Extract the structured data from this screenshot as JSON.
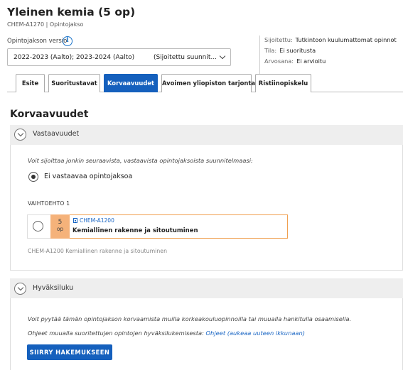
{
  "header": {
    "title": "Yleinen kemia (5 op)",
    "subtitle": "CHEM-A1270 | Opintojakso",
    "version_label": "Opintojakson versio",
    "version_value": "2022-2023 (Aalto); 2023-2024 (Aalto)",
    "version_status": "(Sijoitettu suunnit..."
  },
  "meta": {
    "placement_key": "Sijoitettu:",
    "placement_value": "Tutkintoon kuulumattomat opinnot",
    "state_key": "Tila:",
    "state_value": "Ei suoritusta",
    "grade_key": "Arvosana:",
    "grade_value": "Ei arvioitu"
  },
  "tabs": [
    {
      "label": "Esite",
      "active": false
    },
    {
      "label": "Suoritustavat",
      "active": false
    },
    {
      "label": "Korvaavuudet",
      "active": true
    },
    {
      "label": "Avoimen yliopiston tarjonta",
      "active": false
    },
    {
      "label": "Ristiinopiskelu",
      "active": false
    }
  ],
  "section_title": "Korvaavuudet",
  "equivalents": {
    "heading": "Vastaavuudet",
    "instructions": "Voit sijoittaa jonkin seuraavista, vastaavista opintojaksoista suunnitelmaasi:",
    "no_equivalent_label": "Ei vastaavaa opintojaksoa",
    "alternative_label": "VAIHTOEHTO 1",
    "course": {
      "credits": "5",
      "credit_unit": "op",
      "code": "CHEM-A1200",
      "name": "Kemiallinen rakenne ja sitoutuminen"
    },
    "course_note": "CHEM-A1200 Kemiallinen rakenne ja sitoutuminen"
  },
  "recognition": {
    "heading": "Hyväksiluku",
    "text": "Voit pyytää tämän opintojakson korvaamista muilla korkeakouluopinnoilla tai muualla hankitulla osaamisella.",
    "instructions_prefix": "Ohjeet muualla suoritettujen opintojen hyväksilukemisesta:",
    "instructions_link": "Ohjeet (aukeaa uuteen ikkunaan)",
    "button_label": "SIIRRY HAKEMUKSEEN"
  },
  "colors": {
    "accent": "#1560bd",
    "credit_box": "#f5b27a",
    "course_border": "#f0a050",
    "link": "#1a66c4"
  }
}
